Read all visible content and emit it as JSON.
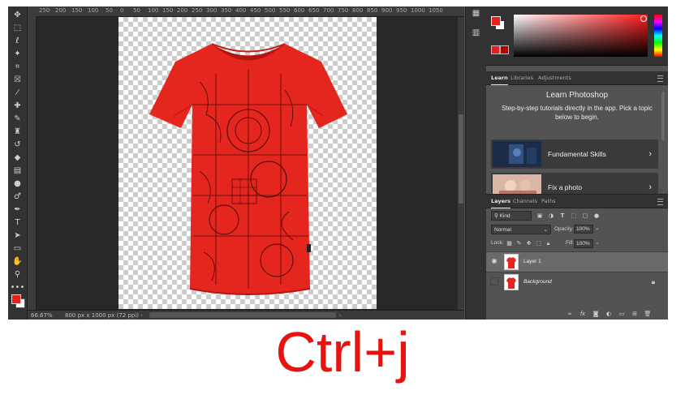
{
  "caption": "Ctrl+j",
  "colors": {
    "foreground": "#e8201c",
    "background": "#ffffff",
    "caption": "#e8120f"
  },
  "ruler": {
    "ticks": [
      "250",
      "200",
      "150",
      "100",
      "50",
      "0",
      "50",
      "100",
      "150",
      "200",
      "250",
      "300",
      "350",
      "400",
      "450",
      "500",
      "550",
      "600",
      "650",
      "700",
      "750",
      "800",
      "850",
      "900",
      "950",
      "1000",
      "1050"
    ]
  },
  "status": {
    "zoom": "66.67%",
    "doc_info": "800 px x 1000 px (72 ppi)"
  },
  "toolbar": {
    "tools": [
      "move-tool",
      "marquee-tool",
      "lasso-tool",
      "magic-wand-tool",
      "crop-tool",
      "frame-tool",
      "eyedropper-tool",
      "healing-brush-tool",
      "brush-tool",
      "clone-stamp-tool",
      "history-brush-tool",
      "eraser-tool",
      "gradient-tool",
      "blur-tool",
      "dodge-tool",
      "pen-tool",
      "type-tool",
      "path-selection-tool",
      "rectangle-tool",
      "hand-tool",
      "zoom-tool",
      "more-tools"
    ]
  },
  "color_panel": {
    "active_hex": "#e8201c"
  },
  "learn_tabs": [
    {
      "label": "Learn",
      "active": true
    },
    {
      "label": "Libraries",
      "active": false
    },
    {
      "label": "Adjustments",
      "active": false
    }
  ],
  "learn": {
    "title": "Learn Photoshop",
    "description": "Step-by-step tutorials directly in the app. Pick a topic below to begin.",
    "cards": [
      {
        "label": "Fundamental Skills"
      },
      {
        "label": "Fix a photo"
      }
    ]
  },
  "layers_tabs": [
    {
      "label": "Layers",
      "active": true
    },
    {
      "label": "Channels",
      "active": false
    },
    {
      "label": "Paths",
      "active": false
    }
  ],
  "layers": {
    "filter_kind": "Kind",
    "blend_mode": "Normal",
    "opacity_label": "Opacity:",
    "opacity": "100%",
    "lock_label": "Lock:",
    "fill_label": "Fill:",
    "fill": "100%",
    "items": [
      {
        "name": "Layer 1",
        "visible": true,
        "selected": true,
        "locked": false
      },
      {
        "name": "Background",
        "visible": false,
        "selected": false,
        "locked": true
      }
    ]
  }
}
